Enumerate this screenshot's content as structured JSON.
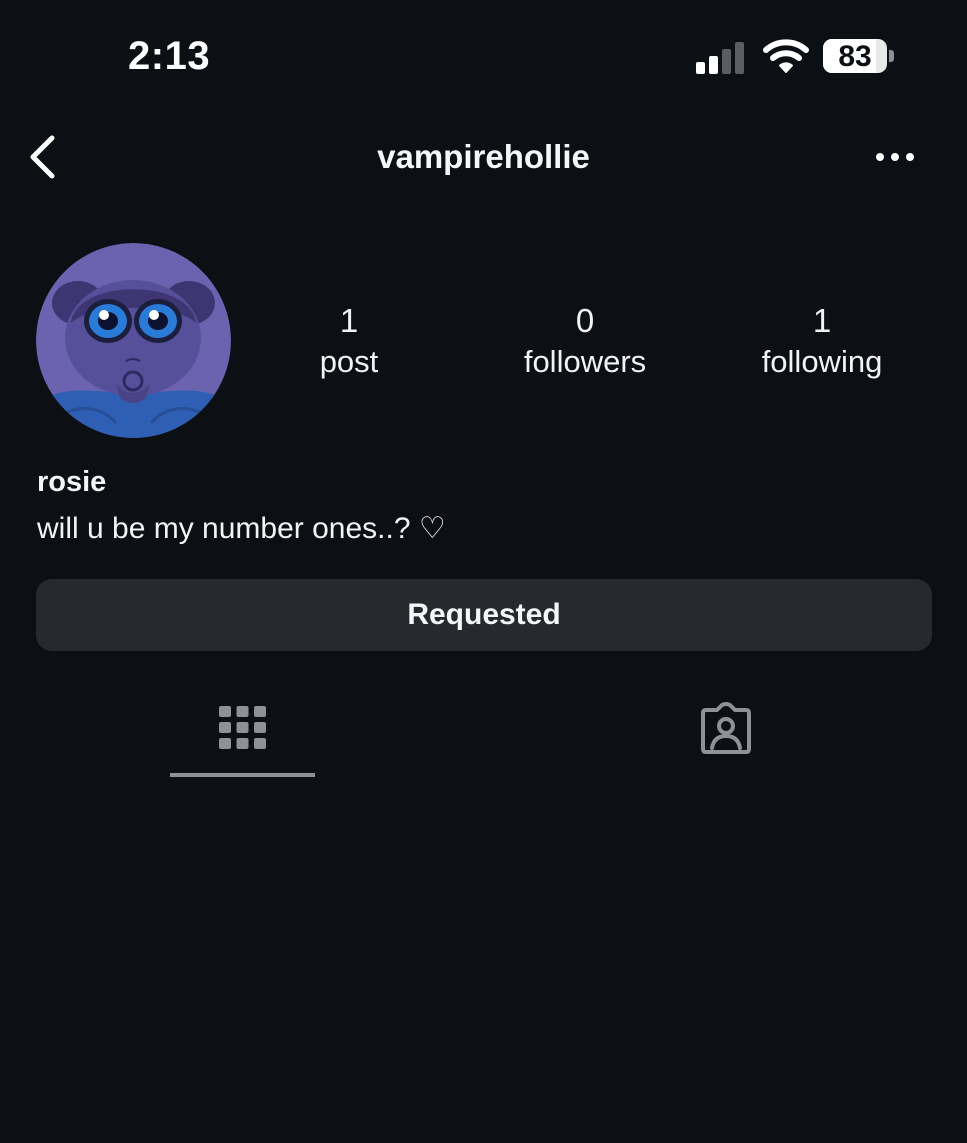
{
  "status_bar": {
    "time": "2:13",
    "battery_level": "83",
    "icons": [
      "cellular-signal-icon",
      "wifi-icon",
      "battery-icon"
    ]
  },
  "nav": {
    "back_icon": "chevron-left-icon",
    "username": "vampirehollie",
    "more_icon": "more-horizontal-icon"
  },
  "profile": {
    "avatar_icon": "profile-avatar",
    "stats": [
      {
        "value": "1",
        "label": "post"
      },
      {
        "value": "0",
        "label": "followers"
      },
      {
        "value": "1",
        "label": "following"
      }
    ],
    "display_name": "rosie",
    "bio": "will u be my number ones..? ♡"
  },
  "actions": {
    "follow_status_label": "Requested"
  },
  "tabs": [
    {
      "icon": "grid-icon",
      "selected": true
    },
    {
      "icon": "tagged-person-icon",
      "selected": false
    }
  ],
  "colors": {
    "background": "#0c0f14",
    "button_background": "#26292e",
    "text": "#f2f3f5",
    "tab_icon": "#8f9197"
  }
}
